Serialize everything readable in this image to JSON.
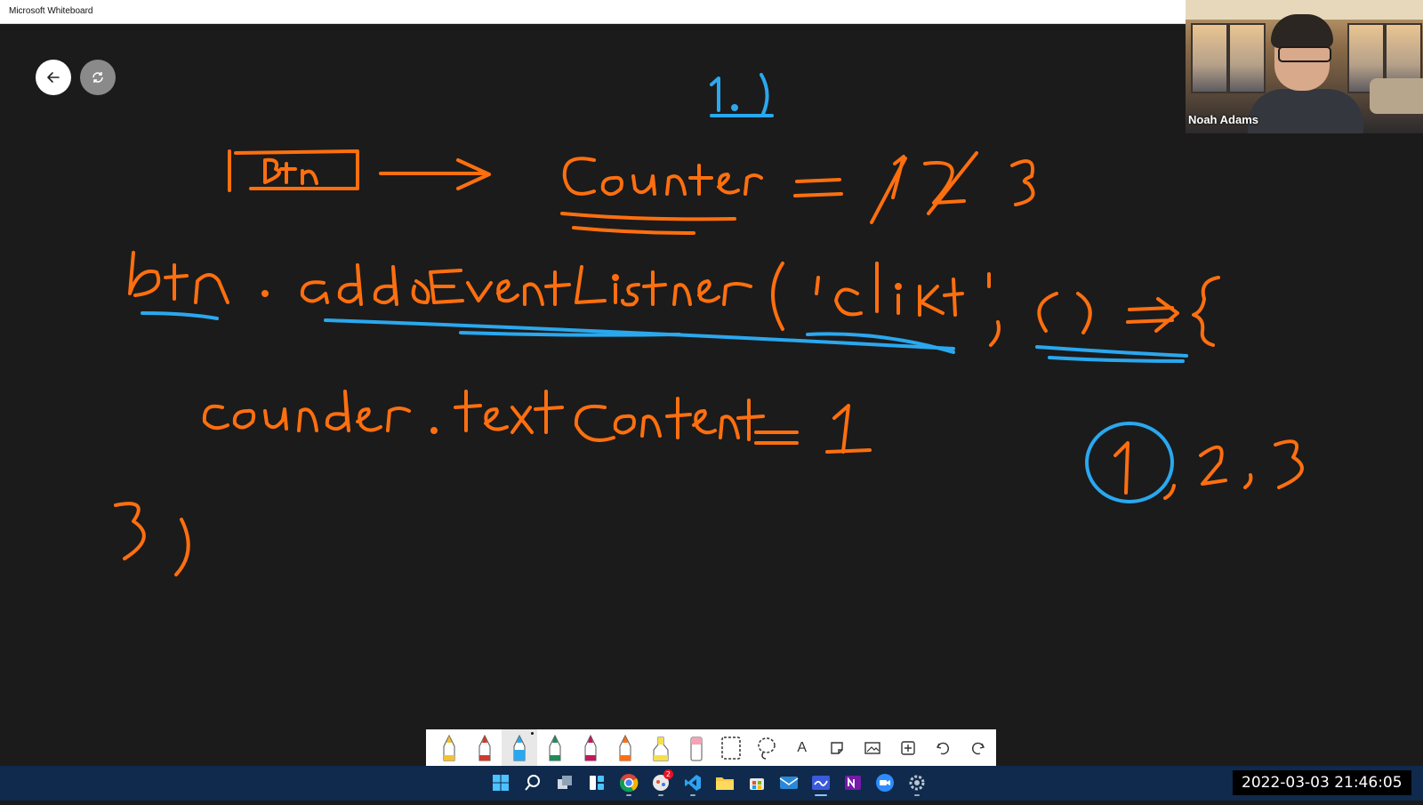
{
  "window": {
    "title": "Microsoft Whiteboard"
  },
  "canvas_controls": {
    "back_icon": "arrow-left-icon",
    "sync_icon": "sync-icon"
  },
  "whiteboard": {
    "handwriting": [
      "1.)",
      "Btn",
      "Counter = 1 2 3",
      "btn. addEventListner('click', () => {",
      "counter. textContent= 1",
      "1, 2, 3",
      "3)"
    ]
  },
  "video_call": {
    "participant_name": "Noah Adams"
  },
  "pen_toolbar": {
    "tools": [
      "pen-yellow-icon",
      "pen-red-icon",
      "pen-blue-icon",
      "pen-green-icon",
      "pen-pink-icon",
      "pen-orange-icon",
      "highlighter-icon",
      "eraser-icon",
      "ruler-icon",
      "lasso-icon",
      "text-icon",
      "note-icon",
      "image-icon",
      "insert-icon",
      "undo-icon",
      "redo-icon"
    ],
    "text_tool_label": "A"
  },
  "taskbar": {
    "apps": [
      "start-icon",
      "search-icon",
      "task-view-icon",
      "widgets-icon",
      "chrome-icon",
      "pinned-app-icon",
      "vscode-icon",
      "file-explorer-icon",
      "store-icon",
      "mail-icon",
      "whiteboard-icon",
      "onenote-icon",
      "zoom-icon",
      "settings-icon"
    ],
    "chat_badge": "2"
  },
  "overlay": {
    "timestamp": "2022-03-03  21:46:05"
  },
  "colors": {
    "orange_ink": "#ff6f0f",
    "blue_ink": "#2aa8ef",
    "canvas_bg": "#1b1b1b",
    "taskbar_bg": "#0f2a4c"
  }
}
